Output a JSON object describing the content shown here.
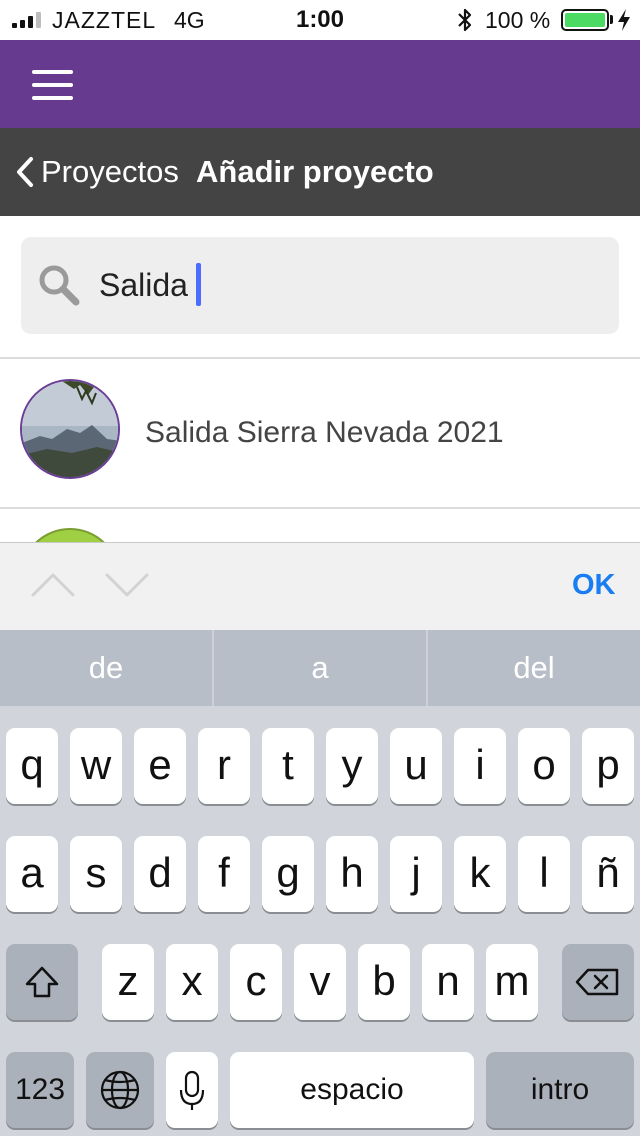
{
  "status_bar": {
    "carrier": "JAZZTEL",
    "network": "4G",
    "time": "1:00",
    "battery_percent": "100 %",
    "battery_color": "#4cd964"
  },
  "app_bar": {
    "color": "#653a8f",
    "menu_icon": "hamburger-icon"
  },
  "nav_bar": {
    "back_label": "Proyectos",
    "title": "Añadir proyecto"
  },
  "search": {
    "value": "Salida",
    "caret_color": "#4a6cff"
  },
  "results": [
    {
      "title": "Salida Sierra Nevada 2021"
    }
  ],
  "keyboard_toolbar": {
    "ok_label": "OK",
    "ok_color": "#1a7df2"
  },
  "predictions": [
    "de",
    "a",
    "del"
  ],
  "keyboard": {
    "row1": [
      "q",
      "w",
      "e",
      "r",
      "t",
      "y",
      "u",
      "i",
      "o",
      "p"
    ],
    "row2": [
      "a",
      "s",
      "d",
      "f",
      "g",
      "h",
      "j",
      "k",
      "l",
      "ñ"
    ],
    "row3": [
      "z",
      "x",
      "c",
      "v",
      "b",
      "n",
      "m"
    ],
    "numbers_label": "123",
    "space_label": "espacio",
    "return_label": "intro"
  }
}
